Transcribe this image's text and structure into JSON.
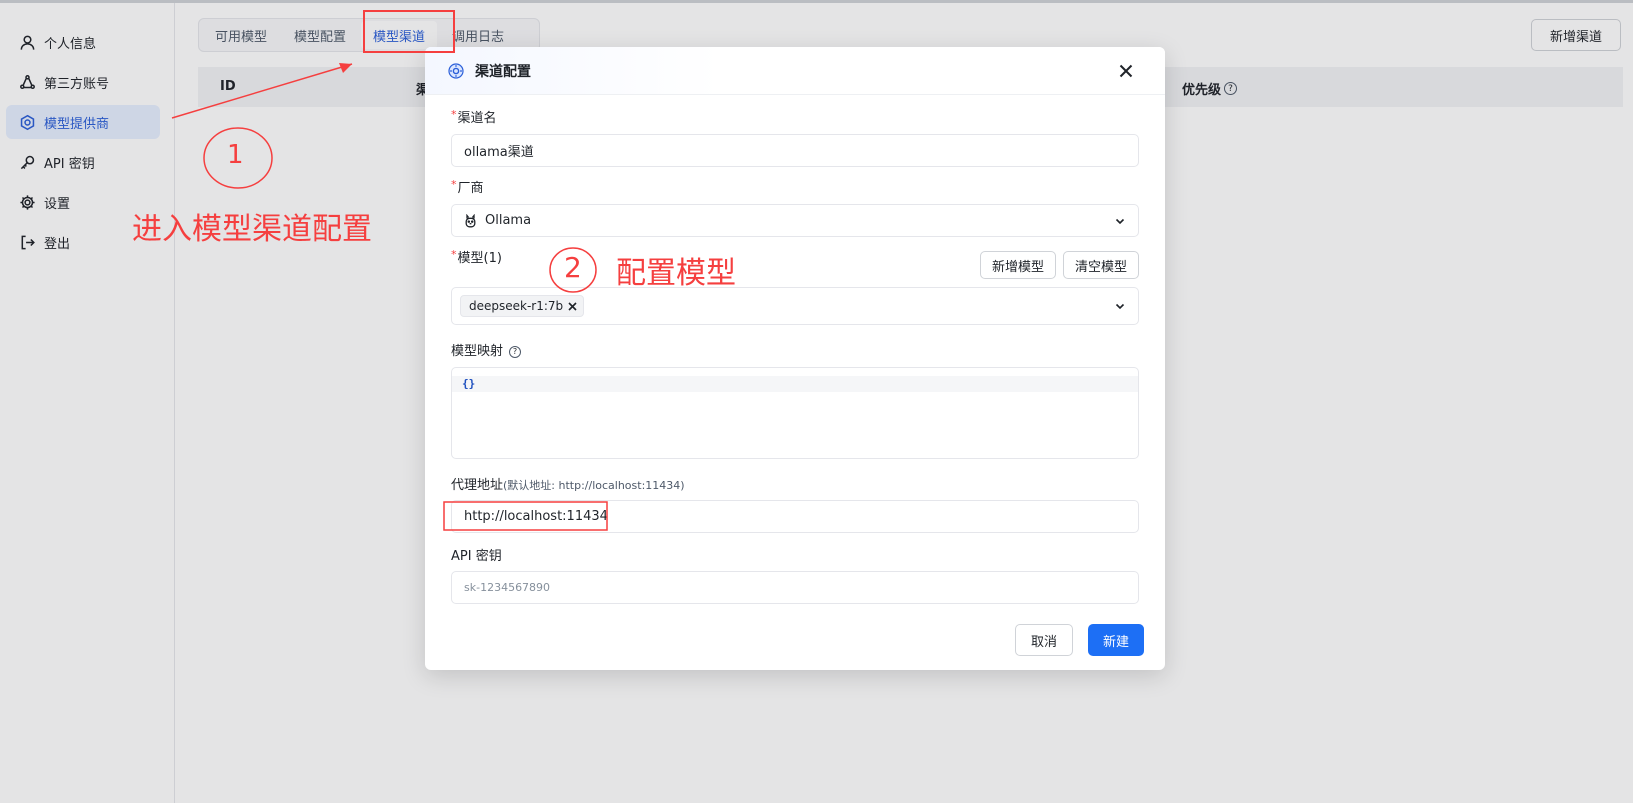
{
  "sidebar": {
    "items": [
      {
        "label": "个人信息",
        "icon": "user-icon",
        "active": false
      },
      {
        "label": "第三方账号",
        "icon": "share-nodes-icon",
        "active": false
      },
      {
        "label": "模型提供商",
        "icon": "provider-icon",
        "active": true
      },
      {
        "label": "API 密钥",
        "icon": "key-icon",
        "active": false
      },
      {
        "label": "设置",
        "icon": "gear-icon",
        "active": false
      },
      {
        "label": "登出",
        "icon": "logout-icon",
        "active": false
      }
    ]
  },
  "tabs": [
    {
      "label": "可用模型",
      "active": false
    },
    {
      "label": "模型配置",
      "active": false
    },
    {
      "label": "模型渠道",
      "active": true
    },
    {
      "label": "调用日志",
      "active": false
    }
  ],
  "header": {
    "new_channel_label": "新增渠道"
  },
  "table": {
    "col_id": "ID",
    "col_fragment": "渠",
    "col_priority": "优先级"
  },
  "modal": {
    "title": "渠道配置",
    "channel_name_label": "渠道名",
    "channel_name_value": "ollama渠道",
    "vendor_label": "厂商",
    "vendor_value": "Ollama",
    "models_label": "模型(1)",
    "add_model_label": "新增模型",
    "clear_models_label": "清空模型",
    "model_tags": [
      "deepseek-r1:7b"
    ],
    "mapping_label": "模型映射",
    "mapping_value": "{}",
    "proxy_label": "代理地址",
    "proxy_hint": "(默认地址: http://localhost:11434)",
    "proxy_value": "http://localhost:11434",
    "api_key_label": "API 密钥",
    "api_key_placeholder": "sk-1234567890",
    "cancel_label": "取消",
    "create_label": "新建"
  },
  "annotations": {
    "step1_number": "1",
    "step1_text": "进入模型渠道配置",
    "step2_number": "2",
    "step2_text": "配置模型",
    "color": "#f53f3f"
  },
  "colors": {
    "accent": "#1d6ff5",
    "active_bg": "#e6efff",
    "required": "#f53f3f"
  }
}
